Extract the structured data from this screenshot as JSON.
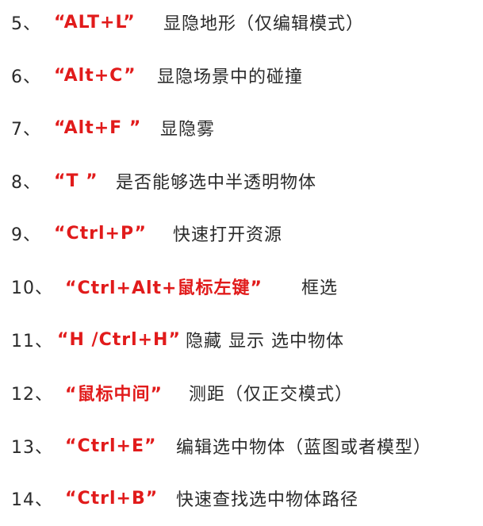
{
  "items": [
    {
      "num": "5、",
      "key": "“ALT+L”",
      "desc": "显隐地形（仅编辑模式）"
    },
    {
      "num": "6、",
      "key": "“Alt+C”",
      "desc": "显隐场景中的碰撞"
    },
    {
      "num": "7、",
      "key": "“Alt+F ”",
      "desc": "显隐雾"
    },
    {
      "num": "8、",
      "key": "“T ”",
      "desc": "是否能够选中半透明物体"
    },
    {
      "num": "9、",
      "key": "“Ctrl+P”",
      "desc": "快速打开资源"
    },
    {
      "num": "10、",
      "key": "“Ctrl+Alt+鼠标左键”",
      "desc": "框选"
    },
    {
      "num": "11、",
      "key": "“H /Ctrl+H”",
      "desc": "隐藏 显示 选中物体"
    },
    {
      "num": "12、",
      "key": "“鼠标中间”",
      "desc": "测距（仅正交模式）"
    },
    {
      "num": "13、",
      "key": "“Ctrl+E”",
      "desc": "编辑选中物体（蓝图或者模型）"
    },
    {
      "num": "14、",
      "key": "“Ctrl+B”",
      "desc": "快速查找选中物体路径"
    }
  ]
}
